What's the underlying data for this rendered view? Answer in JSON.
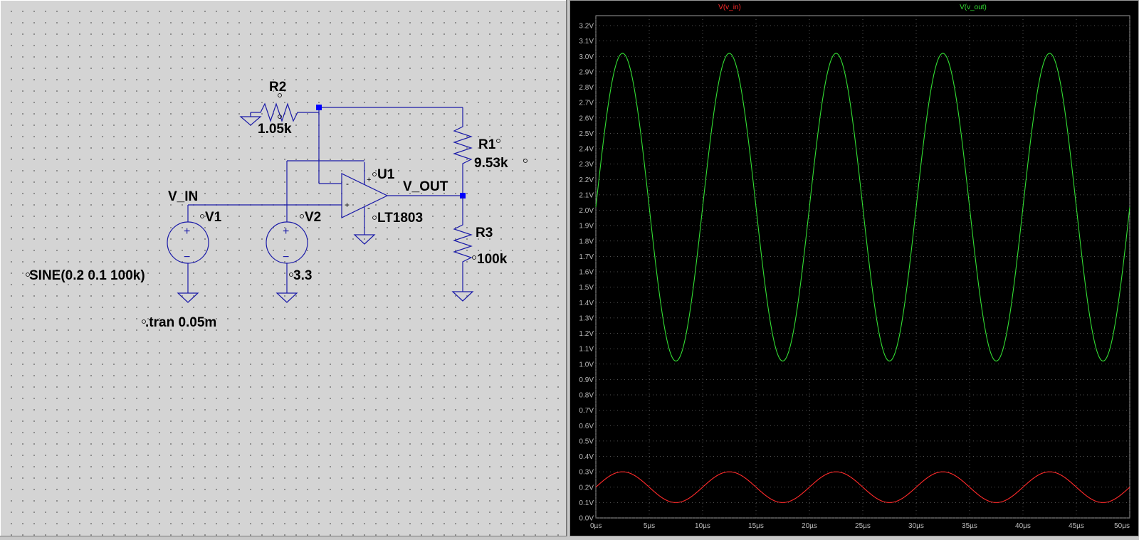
{
  "schematic": {
    "components": {
      "r2": {
        "name": "R2",
        "value": "1.05k"
      },
      "r1": {
        "name": "R1",
        "value": "9.53k"
      },
      "r3": {
        "name": "R3",
        "value": "100k"
      },
      "u1": {
        "name": "U1",
        "value": "LT1803"
      },
      "v1": {
        "name": "V1",
        "value": "SINE(0.2 0.1 100k)"
      },
      "v2": {
        "name": "V2",
        "value": "3.3"
      }
    },
    "nets": {
      "v_in": "V_IN",
      "v_out": "V_OUT"
    },
    "directive": ".tran 0.05m",
    "opamp_pins": {
      "minus": "-",
      "plus": "+",
      "supply_plus": "+",
      "supply_minus": "-"
    },
    "source_symbols": {
      "plus": "+",
      "minus": "−"
    }
  },
  "waveform": {
    "traces": [
      {
        "name": "V(v_in)",
        "color": "#ff2a2a"
      },
      {
        "name": "V(v_out)",
        "color": "#33dd33"
      }
    ]
  },
  "chart_data": {
    "type": "line",
    "xlabel": "",
    "ylabel": "",
    "xlim": [
      0,
      50
    ],
    "ylim": [
      0.0,
      3.2
    ],
    "x_unit": "µs",
    "y_unit": "V",
    "grid": true,
    "x_ticks": [
      "0µs",
      "5µs",
      "10µs",
      "15µs",
      "20µs",
      "25µs",
      "30µs",
      "35µs",
      "40µs",
      "45µs",
      "50µs"
    ],
    "y_ticks": [
      "0.0V",
      "0.1V",
      "0.2V",
      "0.3V",
      "0.4V",
      "0.5V",
      "0.6V",
      "0.7V",
      "0.8V",
      "0.9V",
      "1.0V",
      "1.1V",
      "1.2V",
      "1.3V",
      "1.4V",
      "1.5V",
      "1.6V",
      "1.7V",
      "1.8V",
      "1.9V",
      "2.0V",
      "2.1V",
      "2.2V",
      "2.3V",
      "2.4V",
      "2.5V",
      "2.6V",
      "2.7V",
      "2.8V",
      "2.9V",
      "3.0V",
      "3.1V",
      "3.2V"
    ],
    "series": [
      {
        "name": "V(v_in)",
        "color": "#ff2a2a",
        "waveform": "sine",
        "offset": 0.2,
        "amplitude": 0.1,
        "frequency_khz": 100
      },
      {
        "name": "V(v_out)",
        "color": "#33dd33",
        "waveform": "sine",
        "offset": 2.02,
        "amplitude": 1.0,
        "frequency_khz": 100
      }
    ]
  }
}
